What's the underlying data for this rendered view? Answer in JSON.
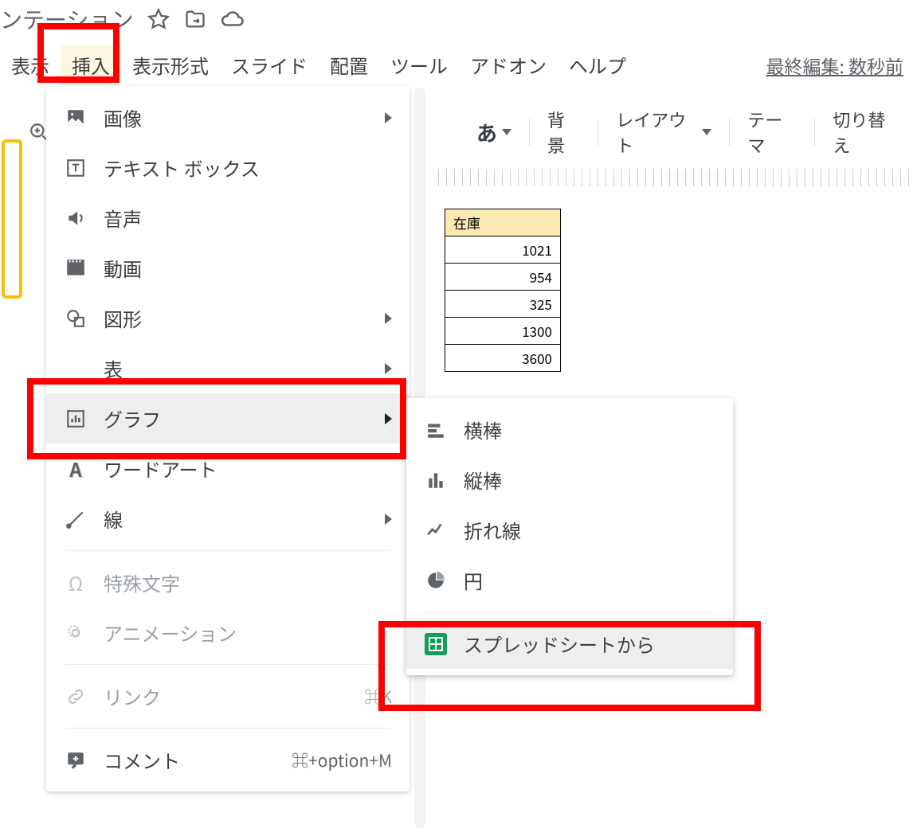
{
  "title_fragment": "ンテーション",
  "menu": {
    "view": "表示",
    "insert": "挿入",
    "format": "表示形式",
    "slide": "スライド",
    "arrange": "配置",
    "tools": "ツール",
    "addons": "アドオン",
    "help": "ヘルプ",
    "last_edit": "最終編集: 数秒前"
  },
  "toolbar": {
    "a_char": "あ",
    "background": "背景",
    "layout": "レイアウト",
    "theme": "テーマ",
    "transition": "切り替え"
  },
  "insert_menu": {
    "image": "画像",
    "textbox": "テキスト ボックス",
    "audio": "音声",
    "video": "動画",
    "shape": "図形",
    "table": "表",
    "chart": "グラフ",
    "wordart": "ワードアート",
    "line": "線",
    "special_chars": "特殊文字",
    "animation": "アニメーション",
    "link": "リンク",
    "link_shortcut": "⌘K",
    "comment": "コメント",
    "comment_shortcut": "⌘+option+M"
  },
  "chart_submenu": {
    "bar_h": "横棒",
    "bar_v": "縦棒",
    "line": "折れ線",
    "pie": "円",
    "from_sheets": "スプレッドシートから"
  },
  "table_data": {
    "header": "在庫",
    "rows": [
      "1021",
      "954",
      "325",
      "1300",
      "3600"
    ]
  }
}
